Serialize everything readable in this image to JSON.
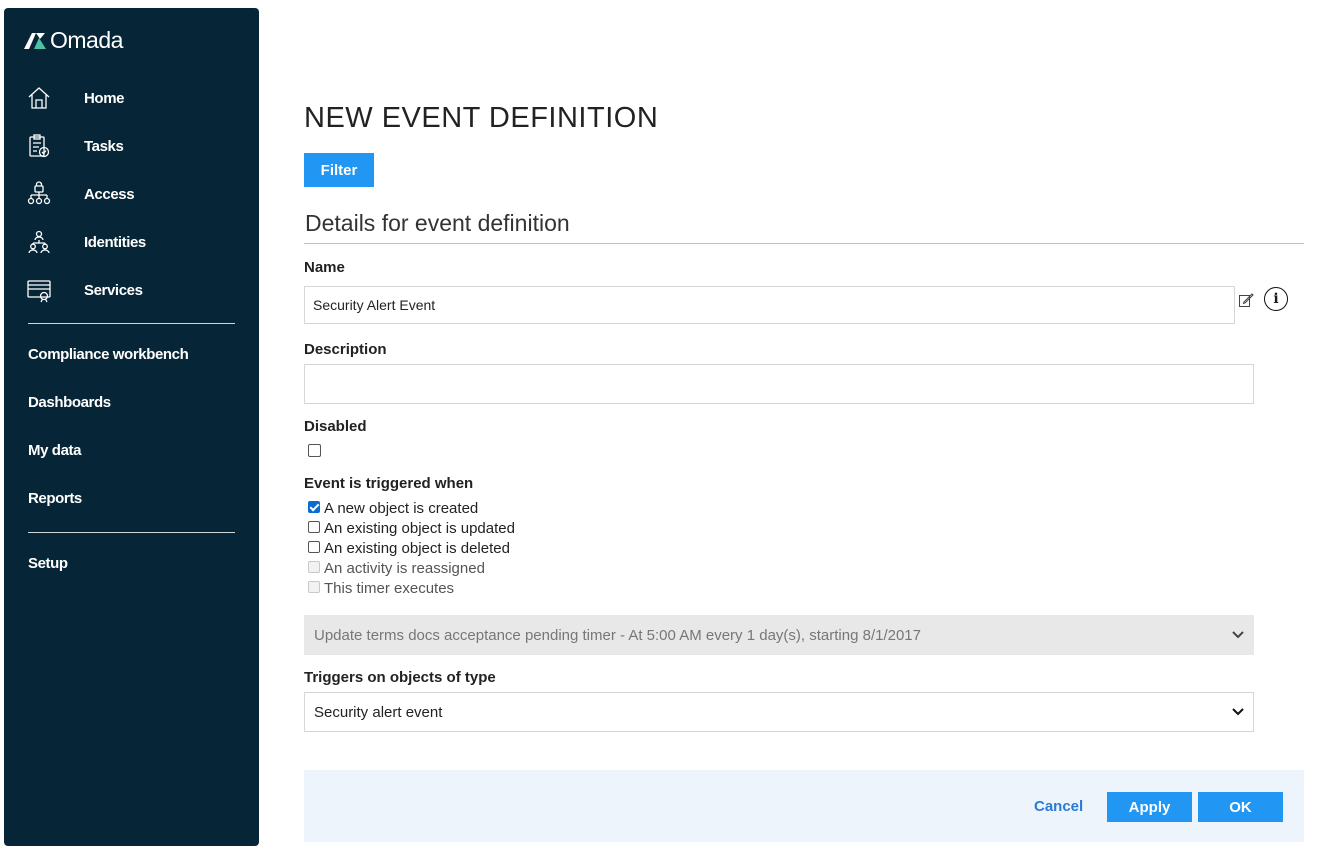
{
  "app": {
    "name": "Omada"
  },
  "sidebar": {
    "primary": [
      {
        "label": "Home",
        "icon": "home-icon"
      },
      {
        "label": "Tasks",
        "icon": "clipboard-check-icon"
      },
      {
        "label": "Access",
        "icon": "access-hierarchy-icon"
      },
      {
        "label": "Identities",
        "icon": "identities-icon"
      },
      {
        "label": "Services",
        "icon": "services-icon"
      }
    ],
    "secondary": [
      "Compliance workbench",
      "Dashboards",
      "My data",
      "Reports"
    ],
    "setup": "Setup"
  },
  "page": {
    "title": "NEW EVENT DEFINITION",
    "filter_button": "Filter",
    "section_title": "Details for event definition"
  },
  "form": {
    "name_label": "Name",
    "name_value": "Security Alert Event",
    "description_label": "Description",
    "description_value": "",
    "disabled_label": "Disabled",
    "disabled_checked": false,
    "trigger_label": "Event is triggered when",
    "triggers": [
      {
        "label": "A new object is created",
        "checked": true,
        "enabled": true
      },
      {
        "label": "An existing object is updated",
        "checked": false,
        "enabled": true
      },
      {
        "label": "An existing object is deleted",
        "checked": false,
        "enabled": true
      },
      {
        "label": "An activity is reassigned",
        "checked": false,
        "enabled": false
      },
      {
        "label": "This timer executes",
        "checked": false,
        "enabled": false
      }
    ],
    "timer_select": "Update terms docs acceptance pending timer - At 5:00 AM every 1 day(s), starting 8/1/2017",
    "object_type_label": "Triggers on objects of type",
    "object_type_value": "Security alert event"
  },
  "footer": {
    "cancel": "Cancel",
    "apply": "Apply",
    "ok": "OK"
  },
  "colors": {
    "sidebar_bg": "#062637",
    "accent": "#2196f3",
    "footer_bg": "#edf4fc",
    "logo_green": "#4fc3a1"
  }
}
